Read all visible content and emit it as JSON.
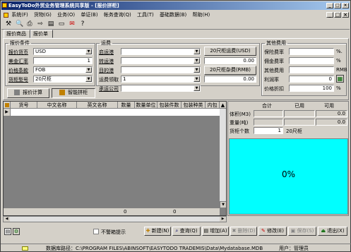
{
  "app": {
    "title": "EasyToDo外贸业务管理系统共享版 - [报价拼柜]",
    "window_buttons": [
      "_",
      "□",
      "×"
    ]
  },
  "menu": [
    {
      "label": "系统(F)"
    },
    {
      "label": "货物(G)"
    },
    {
      "label": "业务(O)"
    },
    {
      "label": "单证(B)"
    },
    {
      "label": "帐务查询(Q)"
    },
    {
      "label": "工具(T)"
    },
    {
      "label": "基础数据(B)"
    },
    {
      "label": "帮助(H)"
    }
  ],
  "mdi_buttons": [
    "_",
    "□",
    "×"
  ],
  "tabs": [
    {
      "label": "报价商品"
    },
    {
      "label": "报价单"
    }
  ],
  "quote_conditions": {
    "legend": "报价条件",
    "currency_label": "报价货币",
    "currency_value": "USD",
    "rate_label": "美金汇率",
    "rate_value": "1",
    "price_terms_label": "价格条款",
    "price_terms_value": "FOB",
    "container_type_label": "货柜型号",
    "container_type_value": "20尺柜"
  },
  "freight": {
    "legend": "运费",
    "start_port_label": "启运港",
    "start_port_value": "",
    "transship_label": "转运港",
    "transship_value": "",
    "dest_port_label": "目的港",
    "dest_port_value": "",
    "freight_method_label": "运费领取",
    "freight_method_value": "1",
    "shipping_co_label": "承运公司",
    "shipping_co_value": "",
    "btn_freight_usd": "20尺柜运费(USD)",
    "freight_usd_value": "0.00",
    "btn_misc_rmb": "20尺柜杂费(RMB)",
    "misc_rmb_value": "0.00"
  },
  "other_fees": {
    "legend": "其他费用",
    "insurance_label": "保险费率",
    "insurance_unit": "%.",
    "commission_label": "佣金费率",
    "commission_unit": "%",
    "other_label": "其他费用",
    "other_unit": "RMB",
    "profit_label": "利润率",
    "profit_value": "0",
    "discount_label": "价格折扣",
    "discount_value": "100",
    "discount_unit": "%"
  },
  "actions": {
    "calc_label": "报价计算",
    "smart_label": "智能拼柜"
  },
  "grid": {
    "columns": [
      "货号",
      "中文名称",
      "英文名称",
      "数量",
      "数量单位",
      "包装件数",
      "包装种类",
      "内包"
    ],
    "footer_values": [
      "0",
      "0"
    ]
  },
  "summary": {
    "headers": [
      "合计",
      "已用",
      "可用"
    ],
    "rows": [
      {
        "label": "体积(M3)",
        "total": "",
        "used": "",
        "avail": "0.0"
      },
      {
        "label": "重量(吨)",
        "total": "",
        "used": "",
        "avail": "0.0"
      },
      {
        "label": "货柜个数",
        "total": "1",
        "used": "20尺柜",
        "avail": ""
      }
    ],
    "percent": "0%"
  },
  "bottom": {
    "no_overweight_label": "不警箱提示",
    "buttons": [
      {
        "label": "新建(N)",
        "enabled": true
      },
      {
        "label": "查询(Q)",
        "enabled": true
      },
      {
        "label": "增加(A)",
        "enabled": true
      },
      {
        "label": "删除(D)",
        "enabled": false
      },
      {
        "label": "修改(E)",
        "enabled": true
      },
      {
        "label": "保存(S)",
        "enabled": false
      },
      {
        "label": "退出(X)",
        "enabled": true
      }
    ]
  },
  "status": {
    "db_path": "数据库路径：C:\\PROGRAM FILES\\ABINSOFT\\EASYTODO TRADEMIS\\Data\\Mydatabase.MDB",
    "user": "用户：管理员"
  },
  "colors": {
    "title_start": "#0a246a",
    "title_end": "#a6caf0",
    "face": "#d4d0c8",
    "percent_bg": "#00ffff"
  },
  "icons": [
    "app-icon",
    "tool-icon",
    "print-preview-icon",
    "print-icon",
    "export-icon",
    "filter-icon",
    "card-icon",
    "help-icon"
  ]
}
